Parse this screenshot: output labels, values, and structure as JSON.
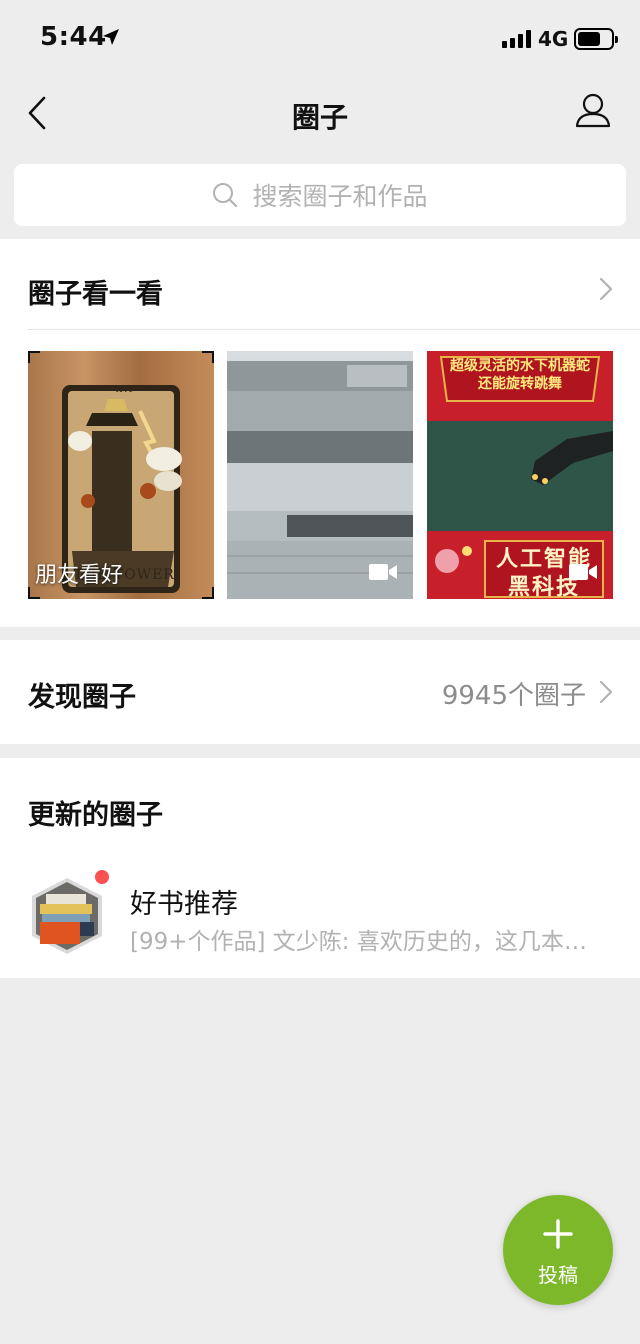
{
  "status_bar": {
    "time": "5:44",
    "network": "4G"
  },
  "header": {
    "title": "圈子"
  },
  "search": {
    "placeholder": "搜索圈子和作品"
  },
  "watch_section": {
    "title": "圈子看一看",
    "thumbnails": [
      {
        "caption": "朋友看好",
        "media": "image",
        "card_text": "XVI",
        "card_title": "THE TOWER."
      },
      {
        "caption": "",
        "media": "video"
      },
      {
        "caption": "",
        "media": "video",
        "overlay_top": [
          "超级灵活的水下机器蛇",
          "还能旋转跳舞"
        ],
        "overlay_bottom": [
          "人工智能",
          "黑科技"
        ]
      }
    ]
  },
  "discover_section": {
    "title": "发现圈子",
    "count_label": "9945个圈子"
  },
  "updated_section": {
    "title": "更新的圈子",
    "items": [
      {
        "name": "好书推荐",
        "preview": "[99+个作品] 文少陈: 喜欢历史的，这几本…",
        "unread": true
      }
    ]
  },
  "fab": {
    "label": "投稿"
  },
  "colors": {
    "accent_green": "#7cb82a",
    "unread_red": "#fa5151",
    "page_bg": "#ededed"
  }
}
